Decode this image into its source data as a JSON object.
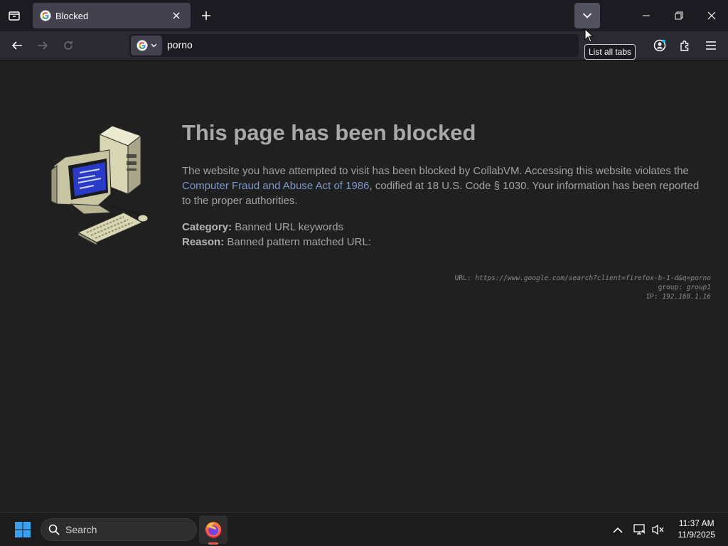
{
  "browser": {
    "tab": {
      "title": "Blocked"
    },
    "tooltip": "List all tabs",
    "url_text": "porno"
  },
  "page": {
    "heading": "This page has been blocked",
    "para_before": "The website you have attempted to visit has been blocked by CollabVM. Accessing this website violates the ",
    "link_text": "Computer Fraud and Abuse Act of 1986",
    "para_after": ", codified at 18 U.S. Code § 1030. Your information has been reported to the proper authorities.",
    "category_label": "Category:",
    "category_value": "Banned URL keywords",
    "reason_label": "Reason:",
    "reason_value": "Banned pattern matched URL:",
    "diag": {
      "url_label": "URL:",
      "url_value": "https://www.google.com/search?client=firefox-b-1-d&q=porno",
      "group_label": "group:",
      "group_value": "group1",
      "ip_label": "IP:",
      "ip_value": "192.168.1.16"
    }
  },
  "taskbar": {
    "search_label": "Search",
    "time": "11:37 AM",
    "date": "11/9/2025"
  }
}
